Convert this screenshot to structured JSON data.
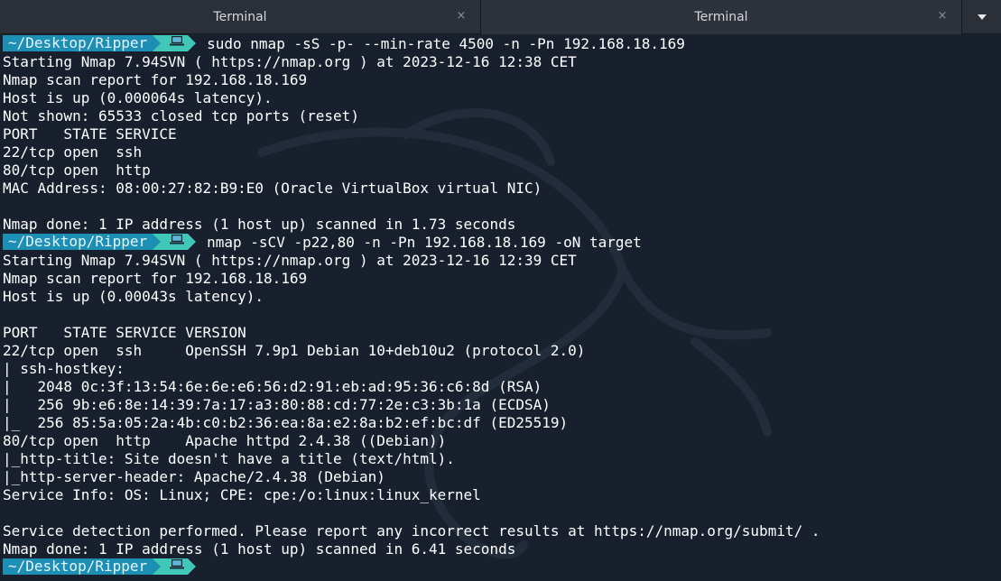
{
  "tabs": [
    {
      "title": "Terminal"
    },
    {
      "title": "Terminal"
    }
  ],
  "tab_close_glyph": "×",
  "prompt": {
    "path": "~/Desktop/Ripper",
    "icon": "laptop-icon",
    "path_color": "#1d8fb5",
    "icon_bg_color": "#41c7b8"
  },
  "terminal": {
    "lines": [
      {
        "type": "prompt",
        "cmd": "sudo nmap -sS -p- --min-rate 4500 -n -Pn 192.168.18.169"
      },
      {
        "type": "text",
        "text": "Starting Nmap 7.94SVN ( https://nmap.org ) at 2023-12-16 12:38 CET"
      },
      {
        "type": "text",
        "text": "Nmap scan report for 192.168.18.169"
      },
      {
        "type": "text",
        "text": "Host is up (0.000064s latency)."
      },
      {
        "type": "text",
        "text": "Not shown: 65533 closed tcp ports (reset)"
      },
      {
        "type": "text",
        "text": "PORT   STATE SERVICE"
      },
      {
        "type": "text",
        "text": "22/tcp open  ssh"
      },
      {
        "type": "text",
        "text": "80/tcp open  http"
      },
      {
        "type": "text",
        "text": "MAC Address: 08:00:27:82:B9:E0 (Oracle VirtualBox virtual NIC)"
      },
      {
        "type": "text",
        "text": ""
      },
      {
        "type": "text",
        "text": "Nmap done: 1 IP address (1 host up) scanned in 1.73 seconds"
      },
      {
        "type": "prompt",
        "cmd": "nmap -sCV -p22,80 -n -Pn 192.168.18.169 -oN target"
      },
      {
        "type": "text",
        "text": "Starting Nmap 7.94SVN ( https://nmap.org ) at 2023-12-16 12:39 CET"
      },
      {
        "type": "text",
        "text": "Nmap scan report for 192.168.18.169"
      },
      {
        "type": "text",
        "text": "Host is up (0.00043s latency)."
      },
      {
        "type": "text",
        "text": ""
      },
      {
        "type": "text",
        "text": "PORT   STATE SERVICE VERSION"
      },
      {
        "type": "text",
        "text": "22/tcp open  ssh     OpenSSH 7.9p1 Debian 10+deb10u2 (protocol 2.0)"
      },
      {
        "type": "text",
        "text": "| ssh-hostkey: "
      },
      {
        "type": "text",
        "text": "|   2048 0c:3f:13:54:6e:6e:e6:56:d2:91:eb:ad:95:36:c6:8d (RSA)"
      },
      {
        "type": "text",
        "text": "|   256 9b:e6:8e:14:39:7a:17:a3:80:88:cd:77:2e:c3:3b:1a (ECDSA)"
      },
      {
        "type": "text",
        "text": "|_  256 85:5a:05:2a:4b:c0:b2:36:ea:8a:e2:8a:b2:ef:bc:df (ED25519)"
      },
      {
        "type": "text",
        "text": "80/tcp open  http    Apache httpd 2.4.38 ((Debian))"
      },
      {
        "type": "text",
        "text": "|_http-title: Site doesn't have a title (text/html)."
      },
      {
        "type": "text",
        "text": "|_http-server-header: Apache/2.4.38 (Debian)"
      },
      {
        "type": "text",
        "text": "Service Info: OS: Linux; CPE: cpe:/o:linux:linux_kernel"
      },
      {
        "type": "text",
        "text": ""
      },
      {
        "type": "text",
        "text": "Service detection performed. Please report any incorrect results at https://nmap.org/submit/ ."
      },
      {
        "type": "text",
        "text": "Nmap done: 1 IP address (1 host up) scanned in 6.41 seconds"
      },
      {
        "type": "prompt",
        "cmd": ""
      }
    ]
  }
}
